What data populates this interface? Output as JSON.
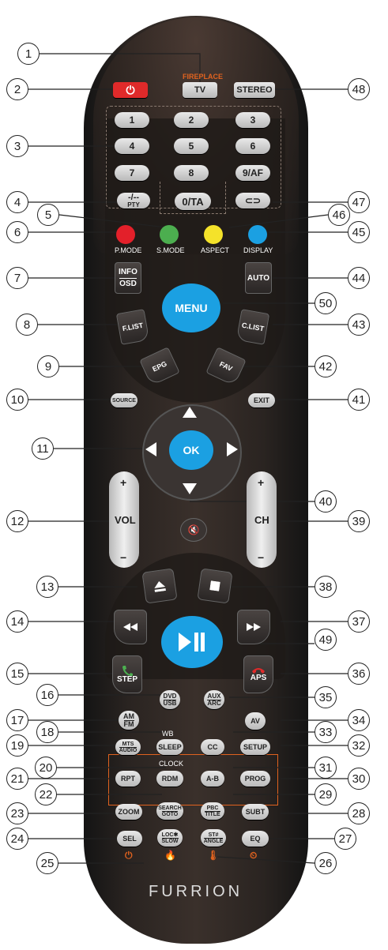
{
  "brand": "FURRION",
  "fireplace_label": "FIREPLACE",
  "wb_label": "WB",
  "clock_label": "CLOCK",
  "buttons": {
    "power": "⏻",
    "tv": "TV",
    "stereo": "STEREO",
    "n1": "1",
    "n2": "2",
    "n3": "3",
    "n4": "4",
    "n5": "5",
    "n6": "6",
    "n7": "7",
    "n8": "8",
    "n9": "9/AF",
    "n0": "0/TA",
    "dash_top": "-/--",
    "dash_bottom": "PTY",
    "return": "⊂⊃",
    "pmode": "P.MODE",
    "smode": "S.MODE",
    "aspect": "ASPECT",
    "display": "DISPLAY",
    "info_top": "INFO",
    "info_bottom": "OSD",
    "auto": "AUTO",
    "menu": "MENU",
    "flist": "F.LIST",
    "clist": "C.LIST",
    "epg": "EPG",
    "fav": "FAV",
    "source": "SOURCE",
    "exit": "EXIT",
    "ok": "OK",
    "vol": "VOL",
    "ch": "CH",
    "plus": "+",
    "minus": "−",
    "mute": "🔇",
    "step": "STEP",
    "aps": "APS",
    "am": "AM",
    "fm": "FM",
    "dvd": "DVD",
    "usb": "USB",
    "aux": "AUX",
    "arc": "ARC",
    "av": "AV",
    "mts": "MTS",
    "audio": "AUDIO",
    "sleep": "SLEEP",
    "cc": "CC",
    "setup": "SETUP",
    "rpt": "RPT",
    "rdm": "RDM",
    "ab": "A-B",
    "prog": "PROG",
    "zoom": "ZOOM",
    "search": "SEARCH",
    "goto": "GOTO",
    "pbc": "PBC",
    "title": "TITLE",
    "subt": "SUBT",
    "sel": "SEL",
    "loc": "LOC✱",
    "slow": "SLOW",
    "st": "ST#",
    "angle": "ANGLE",
    "eq": "EQ"
  },
  "fire_icons": [
    "⏻",
    "🔥",
    "🌡",
    "⏲"
  ],
  "colors": {
    "power": "#e02a2a",
    "red": "#e3202a",
    "green": "#4cae4f",
    "yellow": "#f4e22a",
    "blue": "#1ba0e2",
    "menu": "#1ba0e2",
    "fire": "#e0621f",
    "step_icon": "#4caf50",
    "aps_icon": "#e02a2a"
  },
  "callouts": [
    "1",
    "2",
    "3",
    "4",
    "5",
    "6",
    "7",
    "8",
    "9",
    "10",
    "11",
    "12",
    "13",
    "14",
    "15",
    "16",
    "17",
    "18",
    "19",
    "20",
    "21",
    "22",
    "23",
    "24",
    "25",
    "26",
    "27",
    "28",
    "29",
    "30",
    "31",
    "32",
    "33",
    "34",
    "35",
    "36",
    "37",
    "38",
    "39",
    "40",
    "41",
    "42",
    "43",
    "44",
    "45",
    "46",
    "47",
    "48",
    "49",
    "50"
  ]
}
